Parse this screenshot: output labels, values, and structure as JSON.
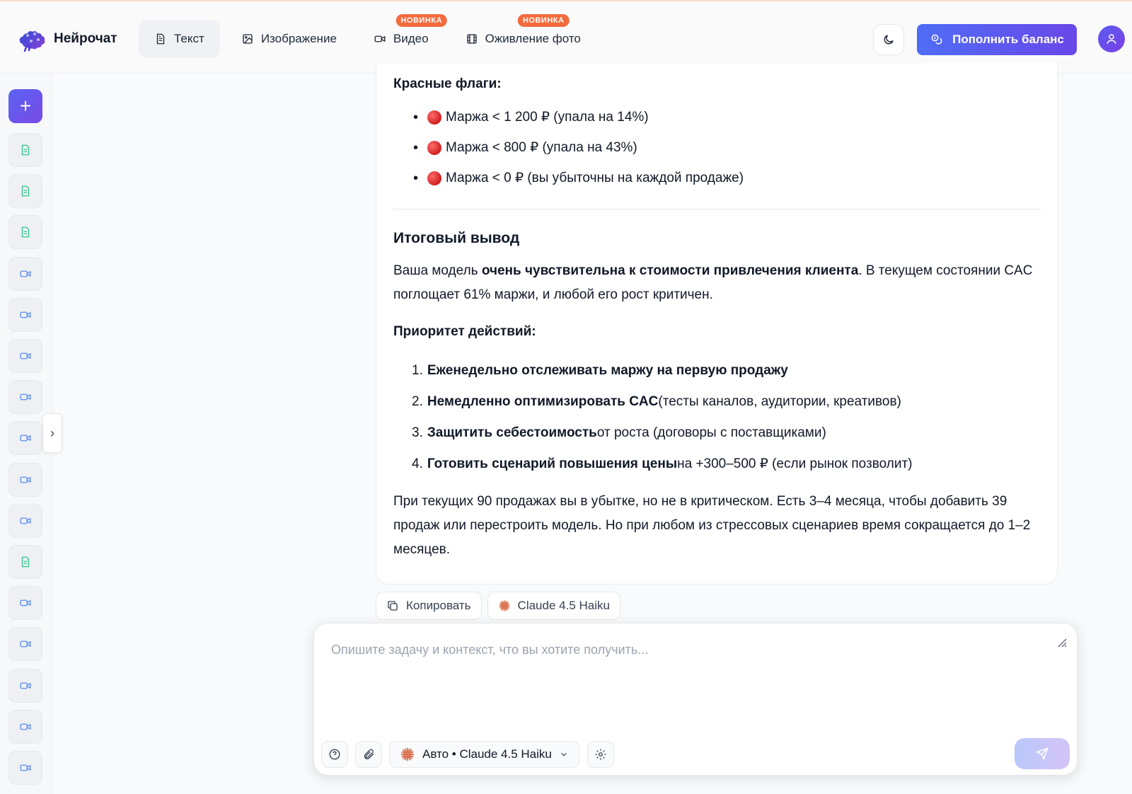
{
  "app": {
    "name": "Нейрочат"
  },
  "nav": [
    {
      "label": "Текст",
      "icon": "document-icon",
      "active": true,
      "badge": ""
    },
    {
      "label": "Изображение",
      "icon": "image-icon",
      "active": false,
      "badge": ""
    },
    {
      "label": "Видео",
      "icon": "video-icon",
      "active": false,
      "badge": "НОВИНКА"
    },
    {
      "label": "Оживление фото",
      "icon": "film-icon",
      "active": false,
      "badge": "НОВИНКА"
    }
  ],
  "header": {
    "topup_label": "Пополнить баланс"
  },
  "sidebar": {
    "items": [
      "doc",
      "doc",
      "doc",
      "vid",
      "vid",
      "vid",
      "vid",
      "vid",
      "vid",
      "vid",
      "doc",
      "vid",
      "vid",
      "vid",
      "vid",
      "vid"
    ]
  },
  "message": {
    "red_flags_title": "Красные флаги:",
    "red_flags": [
      "Маржа < 1 200 ₽ (упала на 14%)",
      "Маржа < 800 ₽ (упала на 43%)",
      "Маржа < 0 ₽ (вы убыточны на каждой продаже)"
    ],
    "final_title": "Итоговый вывод",
    "final_para": {
      "pre": "Ваша модель ",
      "bold": "очень чувствительна к стоимости привлечения клиента",
      "post": ". В текущем состоянии CAC поглощает 61% маржи, и любой его рост критичен."
    },
    "priority_title": "Приоритет действий:",
    "priorities": [
      {
        "num": "1.",
        "bold": "Еженедельно отслеживать маржу на первую продажу",
        "rest": ""
      },
      {
        "num": "2.",
        "bold": "Немедленно оптимизировать CAC",
        "rest": " (тесты каналов, аудитории, креативов)"
      },
      {
        "num": "3.",
        "bold": "Защитить себестоимость",
        "rest": " от роста (договоры с поставщиками)"
      },
      {
        "num": "4.",
        "bold": "Готовить сценарий повышения цены",
        "rest": " на +300–500 ₽ (если рынок позволит)"
      }
    ],
    "closing": "При текущих 90 продажах вы в убытке, но не в критическом. Есть 3–4 месяца, чтобы добавить 39 продаж или перестроить модель. Но при любом из стрессовых сценариев время сокращается до 1–2 месяцев."
  },
  "actions": {
    "copy_label": "Копировать",
    "model_label": "Claude 4.5 Haiku"
  },
  "composer": {
    "placeholder": "Опишите задачу и контекст, что вы хотите получить...",
    "model_select": "Авто • Claude 4.5 Haiku"
  },
  "colors": {
    "accent": "#5a63f2",
    "badge": "#f36b3d",
    "claude": "#d97757"
  }
}
